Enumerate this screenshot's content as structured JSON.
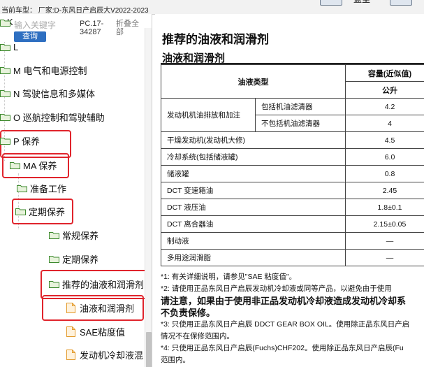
{
  "header": {
    "model_line": "当前车型：  厂家:D-东风日产启辰大V2022-2023",
    "toolbar_label": "篮里"
  },
  "search": {
    "placeholder": "输入关键字",
    "button_label": "查询",
    "code": "PC.17-34287",
    "collapse_label": "折叠全部",
    "k_letter": "K"
  },
  "tree": [
    {
      "label": "L",
      "type": "folder"
    },
    {
      "label": "M 电气和电源控制",
      "type": "folder"
    },
    {
      "label": "N 驾驶信息和多媒体",
      "type": "folder"
    },
    {
      "label": "O 巡航控制和驾驶辅助",
      "type": "folder"
    },
    {
      "label": "P 保养",
      "type": "folder"
    },
    {
      "label": "MA 保养",
      "type": "folder"
    },
    {
      "label": "准备工作",
      "type": "folder"
    },
    {
      "label": "定期保养",
      "type": "folder"
    },
    {
      "label": "常规保养",
      "type": "folder"
    },
    {
      "label": "定期保养",
      "type": "folder"
    },
    {
      "label": "推荐的油液和润滑剂",
      "type": "folder"
    },
    {
      "label": "油液和润滑剂",
      "type": "doc"
    },
    {
      "label": "SAE粘度值",
      "type": "doc"
    },
    {
      "label": "发动机冷却液混",
      "type": "doc"
    }
  ],
  "doc": {
    "title": "推荐的油液和润滑剂",
    "subtitle": "油液和润滑剂",
    "table": {
      "header_type": "油液类型",
      "header_capacity": "容量(近似值)",
      "header_unit": "公升",
      "engine_oil_label": "发动机机油排放和加注",
      "engine_oil_with_filter": "包括机油滤清器",
      "engine_oil_with_filter_value": "4.2",
      "engine_oil_without_filter": "不包括机油滤清器",
      "engine_oil_without_filter_value": "4",
      "rows": [
        {
          "label": "干燥发动机(发动机大修)",
          "value": "4.5"
        },
        {
          "label": "冷却系统(包括储液罐)",
          "value": "6.0"
        },
        {
          "label": "储液罐",
          "value": "0.8"
        },
        {
          "label": "DCT 变速箱油",
          "value": "2.45"
        },
        {
          "label": "DCT 液压油",
          "value": "1.8±0.1"
        },
        {
          "label": "DCT 离合器油",
          "value": "2.15±0.05"
        },
        {
          "label": "制动液",
          "value": "—"
        },
        {
          "label": "多用途润滑脂",
          "value": "—"
        }
      ]
    },
    "notes": [
      "*1: 有关详细说明，请参见\"SAE 粘度值\"。",
      "*2: 请使用正品东风日产启辰发动机冷却液或同等产品，以避免由于使用",
      "请注意，如果由于使用非正品发动机冷却液造成发动机冷却系",
      "不负责保修。",
      "*3: 只使用正品东风日产启辰 DDCT GEAR BOX OIL。使用除正品东风日产启",
      "情况不在保修范围内。",
      "*4: 只使用正品东风日产启辰(Fuchs)CHF202。使用除正品东风日产启辰(Fu",
      "范围内。"
    ]
  }
}
